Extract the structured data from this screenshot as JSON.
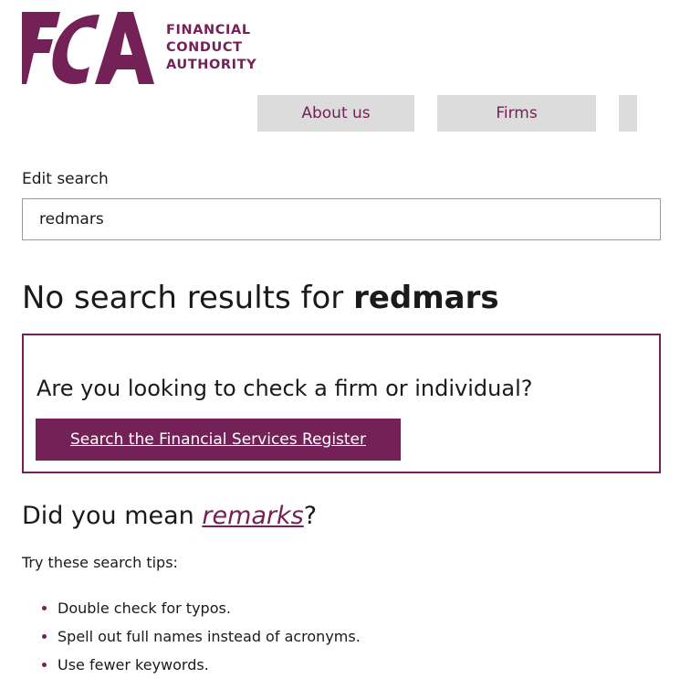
{
  "brand": {
    "logo_text_line1": "FINANCIAL",
    "logo_text_line2": "CONDUCT",
    "logo_text_line3": "AUTHORITY",
    "logo_mark_letters": "FCA",
    "color": "#742157"
  },
  "nav": {
    "items": [
      {
        "label": "About us"
      },
      {
        "label": "Firms"
      },
      {
        "label": ""
      }
    ]
  },
  "search": {
    "label": "Edit search",
    "value": "redmars"
  },
  "results": {
    "heading_prefix": "No search results for ",
    "query": "redmars"
  },
  "register_box": {
    "question": "Are you looking to check a firm or individual?",
    "button_label": "Search the Financial Services Register"
  },
  "suggestion": {
    "prefix": "Did you mean ",
    "term": "remarks",
    "suffix": "?"
  },
  "tips": {
    "intro": "Try these search tips:",
    "items": [
      "Double check for typos.",
      "Spell out full names instead of acronyms.",
      "Use fewer keywords."
    ]
  }
}
